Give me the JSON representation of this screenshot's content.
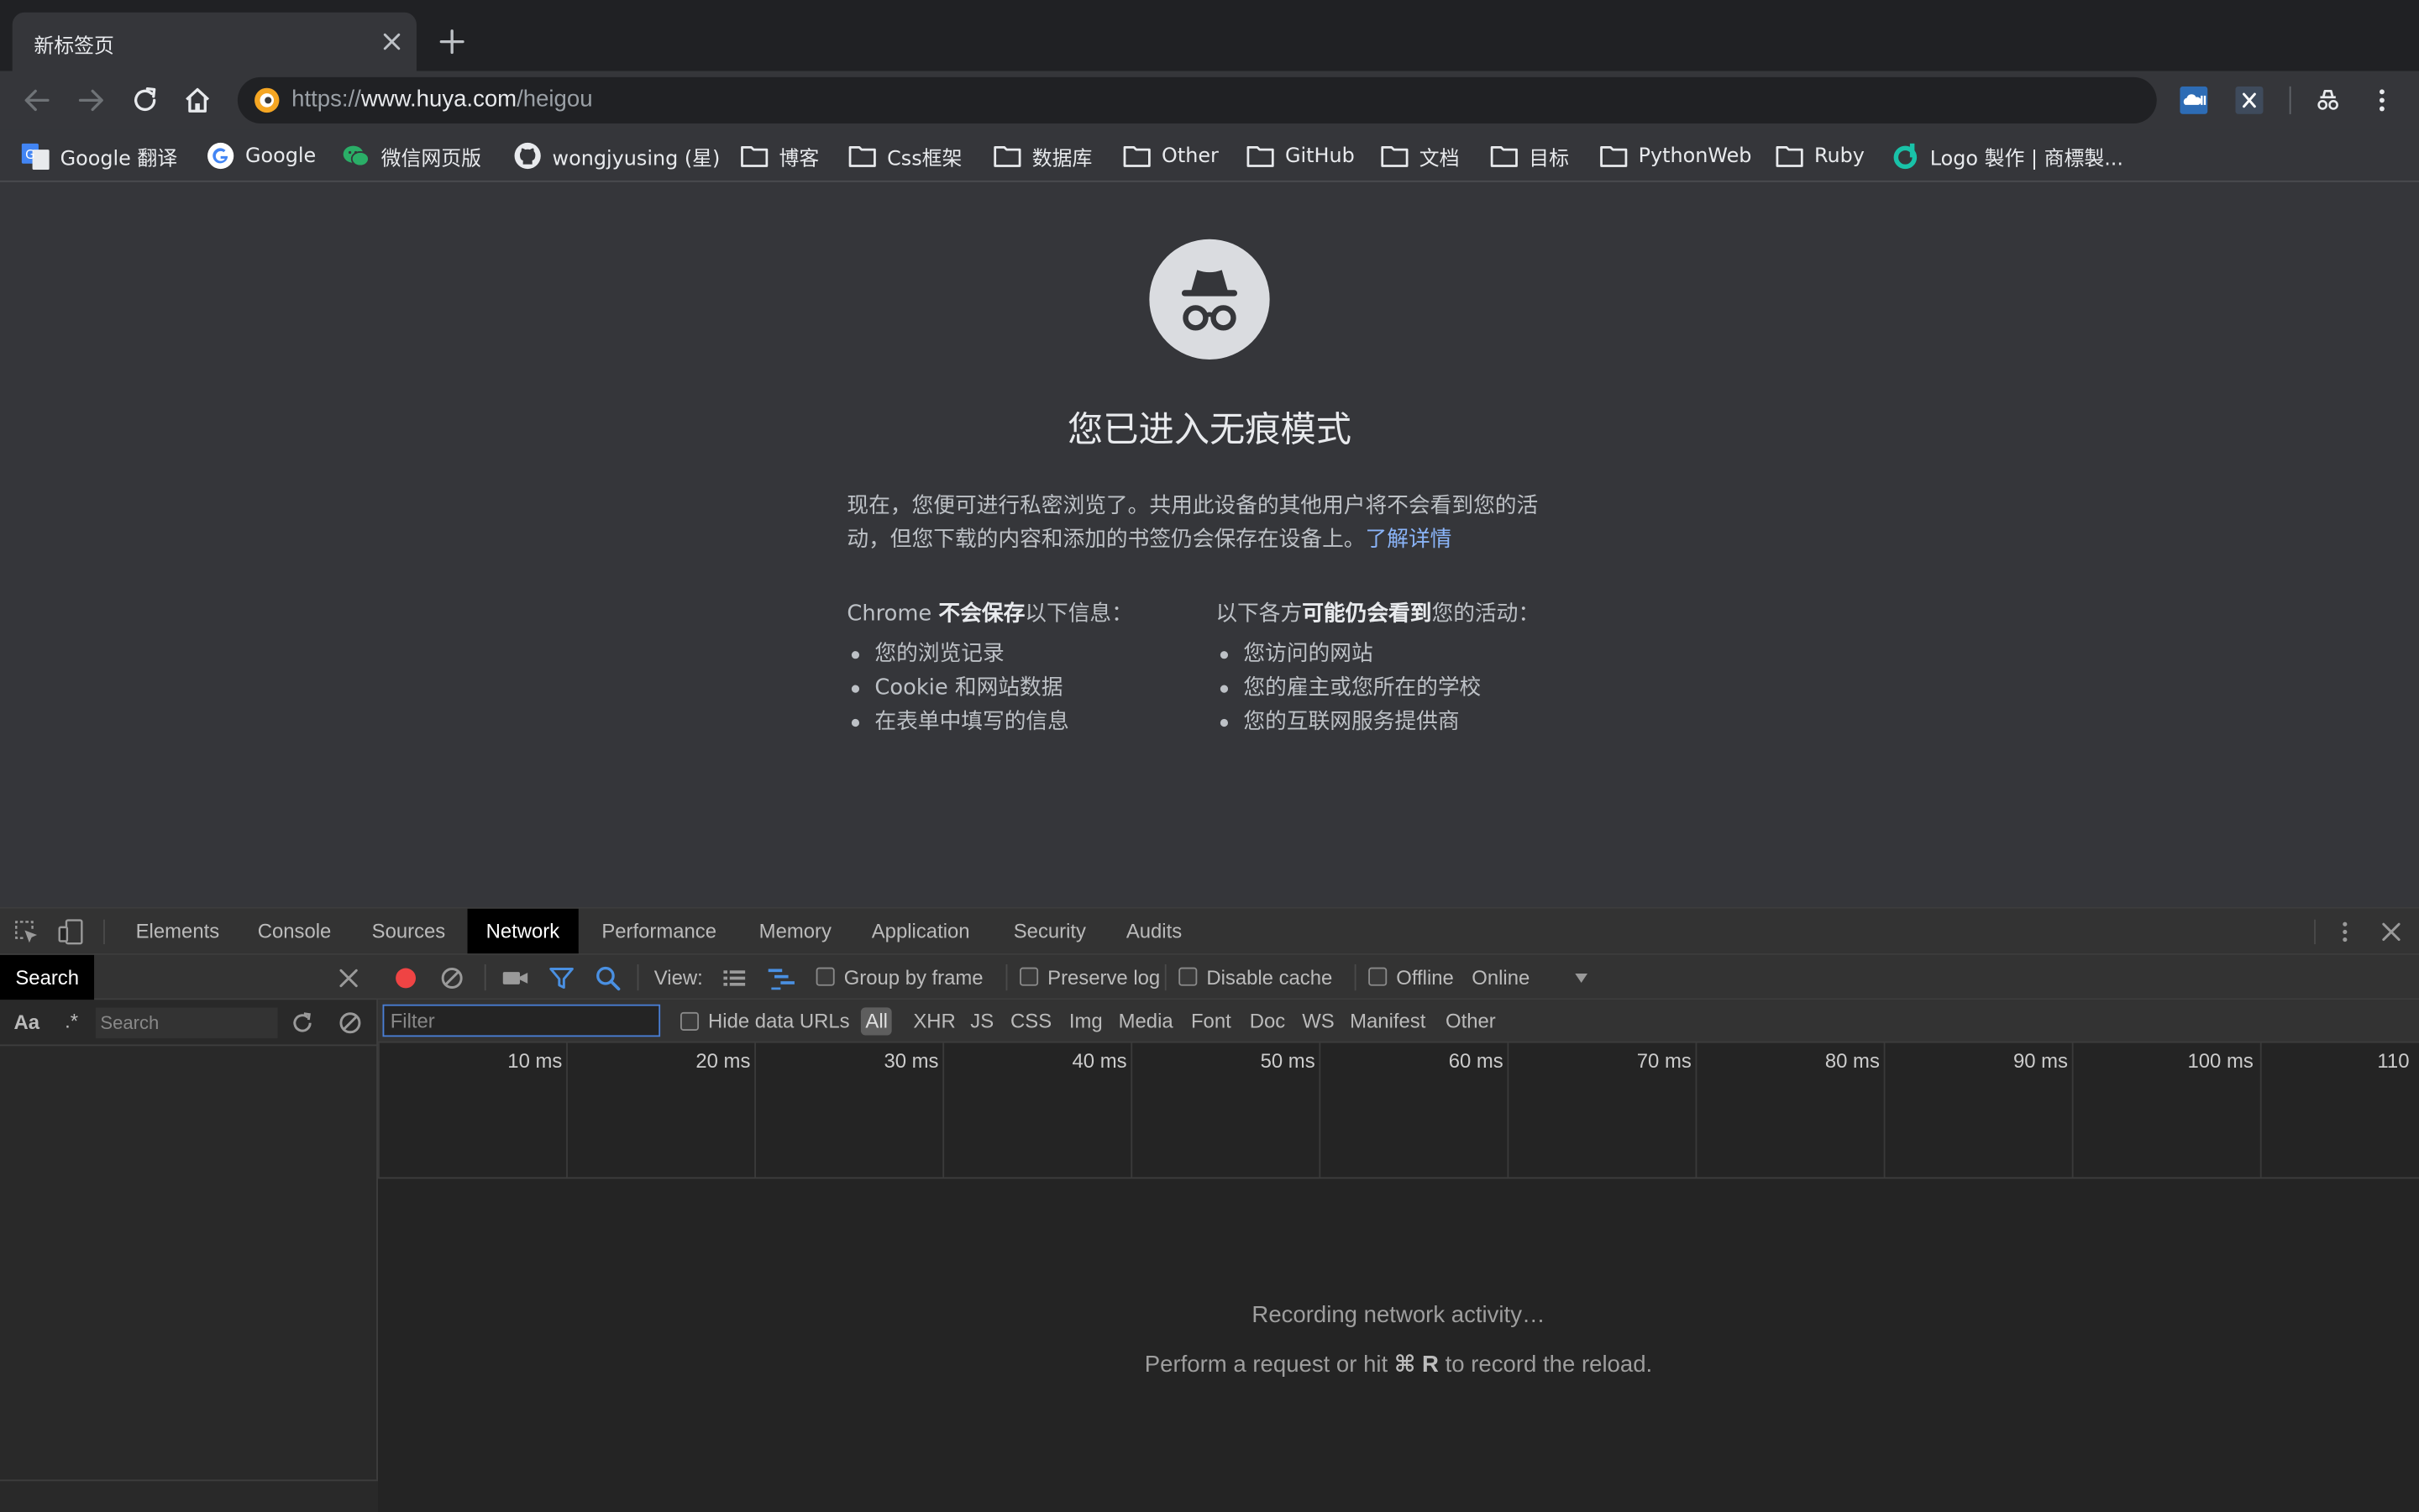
{
  "tab": {
    "title": "新标签页"
  },
  "toolbar": {
    "url_scheme": "https://",
    "url_host": "www.huya.com",
    "url_path": "/heigou"
  },
  "bookmarks": [
    {
      "label": "Google 翻译",
      "icon": "google-translate-icon"
    },
    {
      "label": "Google",
      "icon": "google-icon"
    },
    {
      "label": "微信网页版",
      "icon": "wechat-icon"
    },
    {
      "label": "wongjyusing (星)",
      "icon": "github-icon"
    },
    {
      "label": "博客",
      "icon": "folder-icon"
    },
    {
      "label": "Css框架",
      "icon": "folder-icon"
    },
    {
      "label": "数据库",
      "icon": "folder-icon"
    },
    {
      "label": "Other",
      "icon": "folder-icon"
    },
    {
      "label": "GitHub",
      "icon": "folder-icon"
    },
    {
      "label": "文档",
      "icon": "folder-icon"
    },
    {
      "label": "目标",
      "icon": "folder-icon"
    },
    {
      "label": "PythonWeb",
      "icon": "folder-icon"
    },
    {
      "label": "Ruby",
      "icon": "folder-icon"
    },
    {
      "label": "Logo 製作 | 商標製...",
      "icon": "logo-site-icon"
    }
  ],
  "incognito": {
    "title": "您已进入无痕模式",
    "desc": "现在，您便可进行私密浏览了。共用此设备的其他用户将不会看到您的活动，但您下载的内容和添加的书签仍会保存在设备上。",
    "learn_more": "了解详情",
    "left_head_pre": "Chrome ",
    "left_head_bold": "不会保存",
    "left_head_post": "以下信息：",
    "left_items": [
      "您的浏览记录",
      "Cookie 和网站数据",
      "在表单中填写的信息"
    ],
    "right_head_pre": "以下各方",
    "right_head_bold": "可能仍会看到",
    "right_head_post": "您的活动：",
    "right_items": [
      "您访问的网站",
      "您的雇主或您所在的学校",
      "您的互联网服务提供商"
    ]
  },
  "devtools": {
    "tabs": [
      "Elements",
      "Console",
      "Sources",
      "Network",
      "Performance",
      "Memory",
      "Application",
      "Security",
      "Audits"
    ],
    "active_tab": "Network",
    "search": {
      "title": "Search",
      "case_toggle": "Aa",
      "regex_toggle": ".*",
      "placeholder": "Search"
    },
    "network": {
      "view_label": "View:",
      "group_by_frame": "Group by frame",
      "preserve_log": "Preserve log",
      "disable_cache": "Disable cache",
      "offline": "Offline",
      "throttle": "Online",
      "filter_placeholder": "Filter",
      "hide_data_urls": "Hide data URLs",
      "types": [
        "All",
        "XHR",
        "JS",
        "CSS",
        "Img",
        "Media",
        "Font",
        "Doc",
        "WS",
        "Manifest",
        "Other"
      ],
      "ticks": [
        "10 ms",
        "20 ms",
        "30 ms",
        "40 ms",
        "50 ms",
        "60 ms",
        "70 ms",
        "80 ms",
        "90 ms",
        "100 ms",
        "110"
      ],
      "recording": "Recording network activity…",
      "hint_pre": "Perform a request or hit ",
      "hint_key": "⌘ R",
      "hint_post": " to record the reload."
    }
  },
  "colors": {
    "accent": "#8ab4f8",
    "record": "#ef4444",
    "filter_blue": "#4a90e2"
  }
}
